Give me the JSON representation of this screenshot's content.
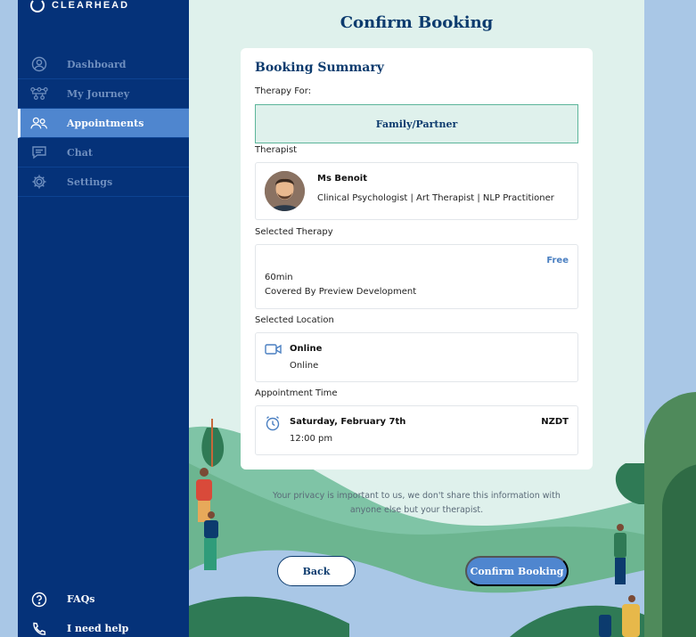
{
  "brand": {
    "name": "CLEARHEAD"
  },
  "sidebar": {
    "items": [
      {
        "label": "Dashboard",
        "icon": "user-circle-icon",
        "active": false
      },
      {
        "label": "My Journey",
        "icon": "journey-path-icon",
        "active": false
      },
      {
        "label": "Appointments",
        "icon": "people-icon",
        "active": true
      },
      {
        "label": "Chat",
        "icon": "chat-icon",
        "active": false
      },
      {
        "label": "Settings",
        "icon": "gear-icon",
        "active": false
      }
    ],
    "bottom": [
      {
        "label": "FAQs",
        "icon": "question-circle-icon"
      },
      {
        "label": "I need help",
        "icon": "phone-icon"
      }
    ]
  },
  "page": {
    "title": "Confirm Booking"
  },
  "summary": {
    "title": "Booking Summary",
    "therapy_for_label": "Therapy For:",
    "therapy_for_value": "Family/Partner",
    "therapist_label": "Therapist",
    "therapist_name": "Ms Benoit",
    "therapist_desc": "Clinical Psychologist | Art Therapist | NLP Practitioner",
    "therapy_label": "Selected Therapy",
    "therapy_price": "Free",
    "therapy_duration": "60min",
    "therapy_covered": "Covered By Preview Development",
    "location_label": "Selected Location",
    "location_title": "Online",
    "location_detail": "Online",
    "time_label": "Appointment Time",
    "time_date": "Saturday, February 7th",
    "time_zone": "NZDT",
    "time_hour": "12:00 pm"
  },
  "privacy_text": "Your privacy is important to us, we don't share this information with anyone else but your therapist.",
  "buttons": {
    "back": "Back",
    "confirm": "Confirm Booking"
  },
  "colors": {
    "sidebar_bg": "#053279",
    "accent": "#4f86cf",
    "title": "#0c3b6e",
    "selected_bg": "#dff1ec",
    "selected_border": "#5cb59a"
  }
}
